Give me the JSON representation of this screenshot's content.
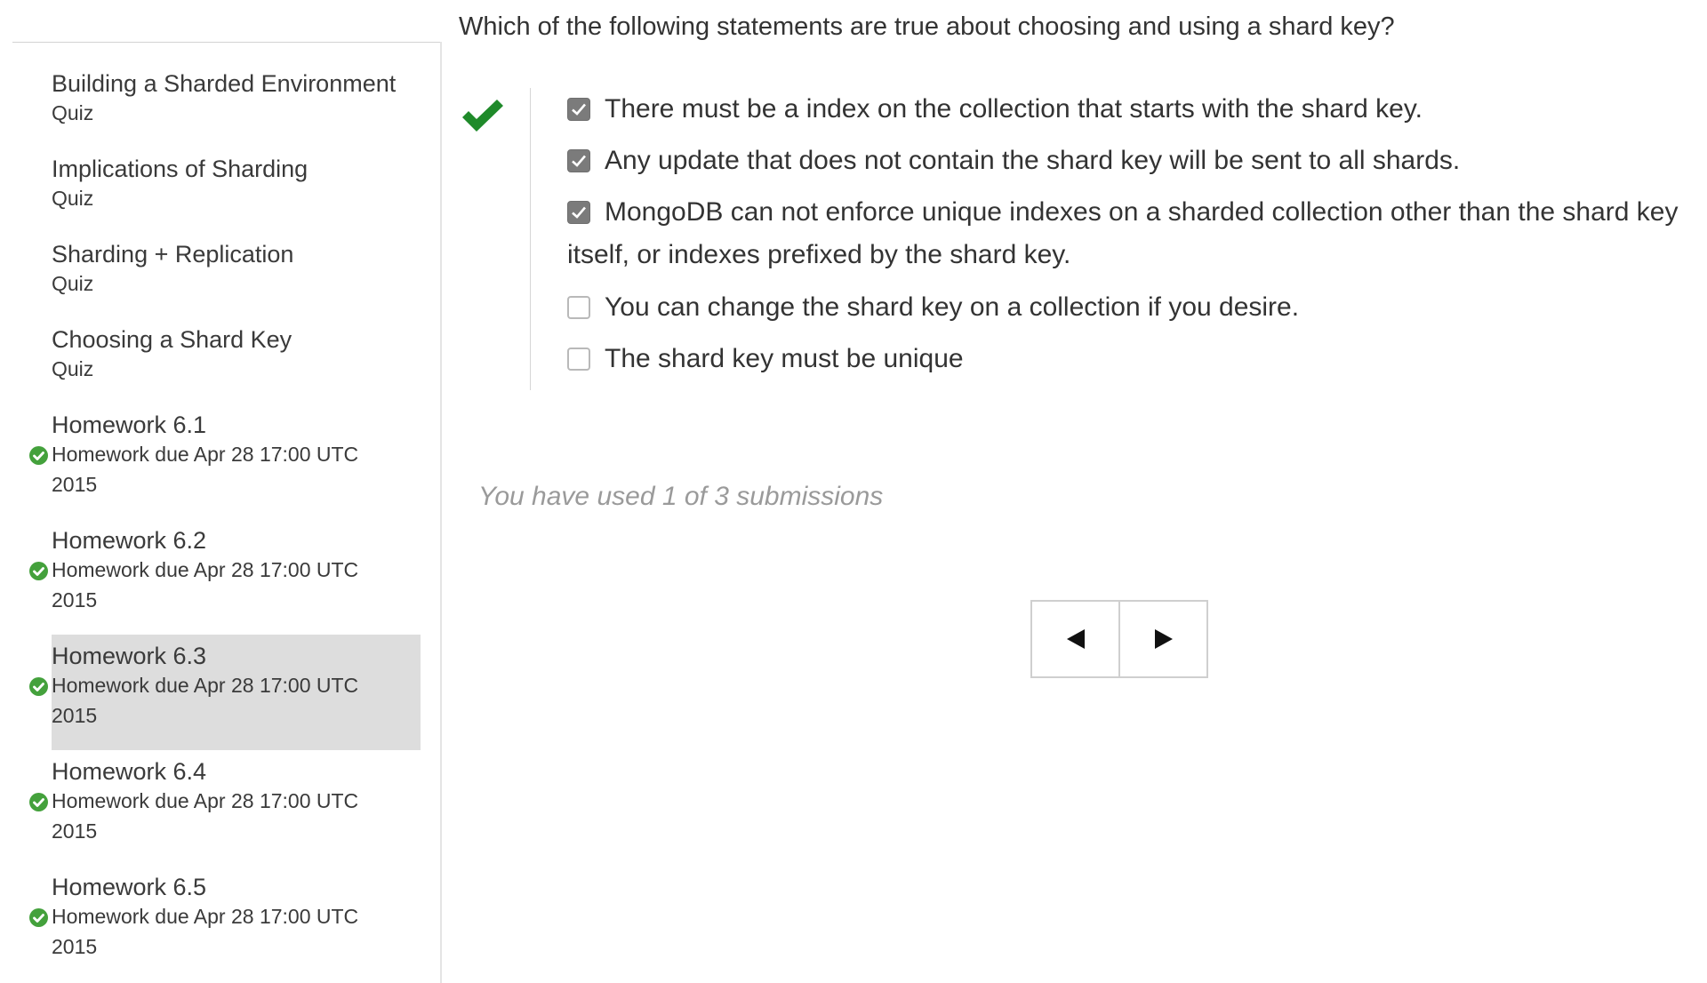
{
  "sidebar": {
    "items": [
      {
        "title": "Building a Sharded Environment",
        "subtitle": "Quiz"
      },
      {
        "title": "Implications of Sharding",
        "subtitle": "Quiz"
      },
      {
        "title": "Sharding + Replication",
        "subtitle": "Quiz"
      },
      {
        "title": "Choosing a Shard Key",
        "subtitle": "Quiz"
      },
      {
        "title": "Homework 6.1",
        "subtitle": "Homework due Apr 28 17:00 UTC 2015",
        "completed": true
      },
      {
        "title": "Homework 6.2",
        "subtitle": "Homework due Apr 28 17:00 UTC 2015",
        "completed": true
      },
      {
        "title": "Homework 6.3",
        "subtitle": "Homework due Apr 28 17:00 UTC 2015",
        "completed": true,
        "active": true
      },
      {
        "title": "Homework 6.4",
        "subtitle": "Homework due Apr 28 17:00 UTC 2015",
        "completed": true
      },
      {
        "title": "Homework 6.5",
        "subtitle": "Homework due Apr 28 17:00 UTC 2015",
        "completed": true
      }
    ]
  },
  "problem": {
    "question": "Which of the following statements are true about choosing and using a shard key?",
    "status": "correct",
    "choices": [
      {
        "text": "There must be a index on the collection that starts with the shard key.",
        "checked": true
      },
      {
        "text": "Any update that does not contain the shard key will be sent to all shards.",
        "checked": true
      },
      {
        "text": "MongoDB can not enforce unique indexes on a sharded collection other than the shard key itself, or indexes prefixed by the shard key.",
        "checked": true
      },
      {
        "text": "You can change the shard key on a collection if you desire.",
        "checked": false
      },
      {
        "text": "The shard key must be unique",
        "checked": false
      }
    ],
    "submissions_text": "You have used 1 of 3 submissions"
  },
  "colors": {
    "accent_green": "#44a13c",
    "correct_green": "#1f8a2a",
    "active_item_bg": "#dddddd",
    "checked_box": "#7b7b7b"
  },
  "icons": {
    "correct": "checkmark-icon",
    "completed": "check-circle-icon",
    "prev": "triangle-left-icon",
    "next": "triangle-right-icon"
  }
}
